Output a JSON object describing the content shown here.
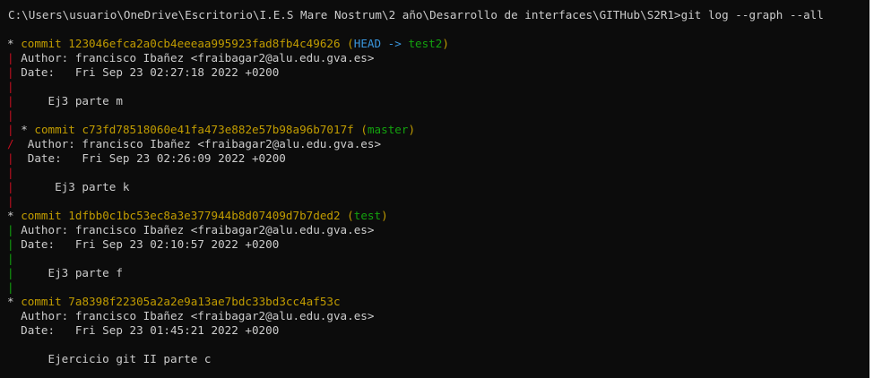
{
  "prompt": {
    "text": "C:\\Users\\usuario\\OneDrive\\Escritorio\\I.E.S Mare Nostrum\\2 año\\Desarrollo de interfaces\\GITHub\\S2R1>git log --graph --all"
  },
  "graph": {
    "star": "*",
    "bar": "|",
    "merge": "/"
  },
  "commits": [
    {
      "label": "commit",
      "hash": "123046efca2a0cb4eeeaa995923fad8fb4c49626",
      "refs_open": "(",
      "head": "HEAD ->",
      "branch": "test2",
      "refs_close": ")",
      "author": "Author: francisco Ibañez <fraibagar2@alu.edu.gva.es>",
      "date": "Date:   Fri Sep 23 02:27:18 2022 +0200",
      "message": "Ej3 parte m"
    },
    {
      "label": "commit",
      "hash": "c73fd78518060e41fa473e882e57b98a96b7017f",
      "refs_open": "(",
      "branch": "master",
      "refs_close": ")",
      "author": "Author: francisco Ibañez <fraibagar2@alu.edu.gva.es>",
      "date": "Date:   Fri Sep 23 02:26:09 2022 +0200",
      "message": "Ej3 parte k"
    },
    {
      "label": "commit",
      "hash": "1dfbb0c1bc53ec8a3e377944b8d07409d7b7ded2",
      "refs_open": "(",
      "branch": "test",
      "refs_close": ")",
      "author": "Author: francisco Ibañez <fraibagar2@alu.edu.gva.es>",
      "date": "Date:   Fri Sep 23 02:10:57 2022 +0200",
      "message": "Ej3 parte f"
    },
    {
      "label": "commit",
      "hash": "7a8398f22305a2a2e9a13ae7bdc33bd3cc4af53c",
      "author": "Author: francisco Ibañez <fraibagar2@alu.edu.gva.es>",
      "date": "Date:   Fri Sep 23 01:45:21 2022 +0200",
      "message": "Ejercicio git II parte c"
    }
  ],
  "colors": {
    "background": "#0c0c0c",
    "text": "#cccccc",
    "hash": "#c19c00",
    "head": "#3a96dd",
    "branch": "#13a10e",
    "graph_red": "#c50f1f",
    "graph_green": "#13a10e"
  }
}
